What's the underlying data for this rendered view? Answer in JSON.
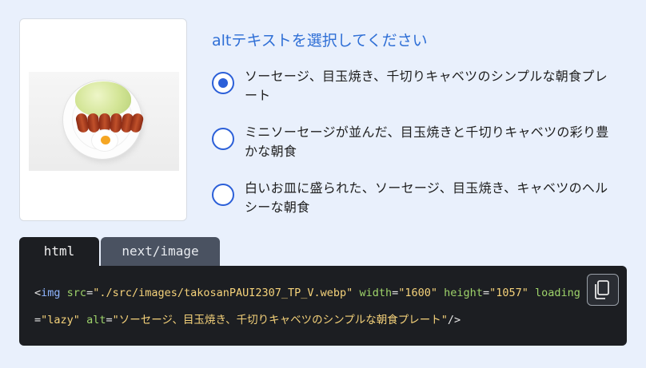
{
  "question": "altテキストを選択してください",
  "options": [
    {
      "label": "ソーセージ、目玉焼き、千切りキャベツのシンプルな朝食プレート",
      "selected": true
    },
    {
      "label": "ミニソーセージが並んだ、目玉焼きと千切りキャベツの彩り豊かな朝食",
      "selected": false
    },
    {
      "label": "白いお皿に盛られた、ソーセージ、目玉焼き、キャベツのヘルシーな朝食",
      "selected": false
    }
  ],
  "tabs": [
    {
      "label": "html",
      "active": true
    },
    {
      "label": "next/image",
      "active": false
    }
  ],
  "code": {
    "open": "<",
    "tag": "img",
    "src_attr": "src",
    "src_val": "\"./src/images/takosanPAUI2307_TP_V.webp\"",
    "width_attr": "width",
    "width_val": "\"1600\"",
    "height_attr": "height",
    "height_val": "\"1057\"",
    "loading_attr": "loading",
    "eq": "=",
    "loading_val": "\"lazy\"",
    "alt_attr": "alt",
    "alt_val": "\"ソーセージ、目玉焼き、千切りキャベツのシンプルな朝食プレート\"",
    "close": "/>"
  },
  "copy_button": {
    "icon": "copy-icon"
  },
  "colors": {
    "background": "#e9f0fc",
    "accent": "#2b5fd8",
    "code_bg": "#1c1e22",
    "tab_inactive": "#4a5261"
  }
}
